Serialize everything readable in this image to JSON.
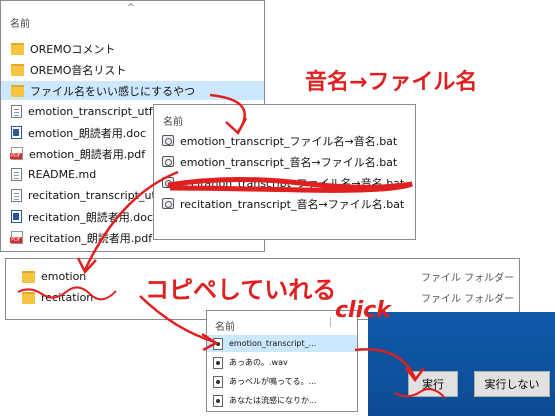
{
  "explorer_main": {
    "header": "名前",
    "items": [
      {
        "icon": "folder",
        "label": "OREMOコメント"
      },
      {
        "icon": "folder",
        "label": "OREMO音名リスト"
      },
      {
        "icon": "folder",
        "label": "ファイル名をいい感じにするやつ",
        "selected": true
      },
      {
        "icon": "text",
        "label": "emotion_transcript_utf"
      },
      {
        "icon": "word",
        "label": "emotion_朗読者用.doc"
      },
      {
        "icon": "pdf",
        "label": "emotion_朗読者用.pdf"
      },
      {
        "icon": "text",
        "label": "README.md"
      },
      {
        "icon": "text",
        "label": "recitation_transcript_utf"
      },
      {
        "icon": "word",
        "label": "recitation_朗読者用.doc"
      },
      {
        "icon": "pdf",
        "label": "recitation_朗読者用.pdf"
      }
    ]
  },
  "explorer_bat": {
    "header": "名前",
    "items": [
      {
        "label": "emotion_transcript_ファイル名→音名.bat"
      },
      {
        "label": "emotion_transcript_音名→ファイル名.bat"
      },
      {
        "label": "recitation_transcript_ファイル名→音名.bat"
      },
      {
        "label": "recitation_transcript_音名→ファイル名.bat"
      }
    ]
  },
  "explorer_folders": {
    "items": [
      {
        "label": "emotion",
        "type": "ファイル フォルダー"
      },
      {
        "label": "recitation",
        "type": "ファイル フォルダー"
      }
    ]
  },
  "explorer_small": {
    "header": "名前",
    "items": [
      {
        "label": "emotion_transcript_...",
        "selected": true
      },
      {
        "label": "あっあの。.wav"
      },
      {
        "label": "あっベルが鳴ってる。..."
      },
      {
        "label": "あなたは流感になりか..."
      }
    ]
  },
  "dialog": {
    "run_label": "実行",
    "cancel_label": "実行しない"
  },
  "annotations": {
    "top": "音名→ファイル名",
    "copy": "コピペしていれる",
    "click": "click"
  },
  "colors": {
    "annotation": "#e02020",
    "dialog_bg": "#0b4c94",
    "selection": "#cce8ff"
  }
}
